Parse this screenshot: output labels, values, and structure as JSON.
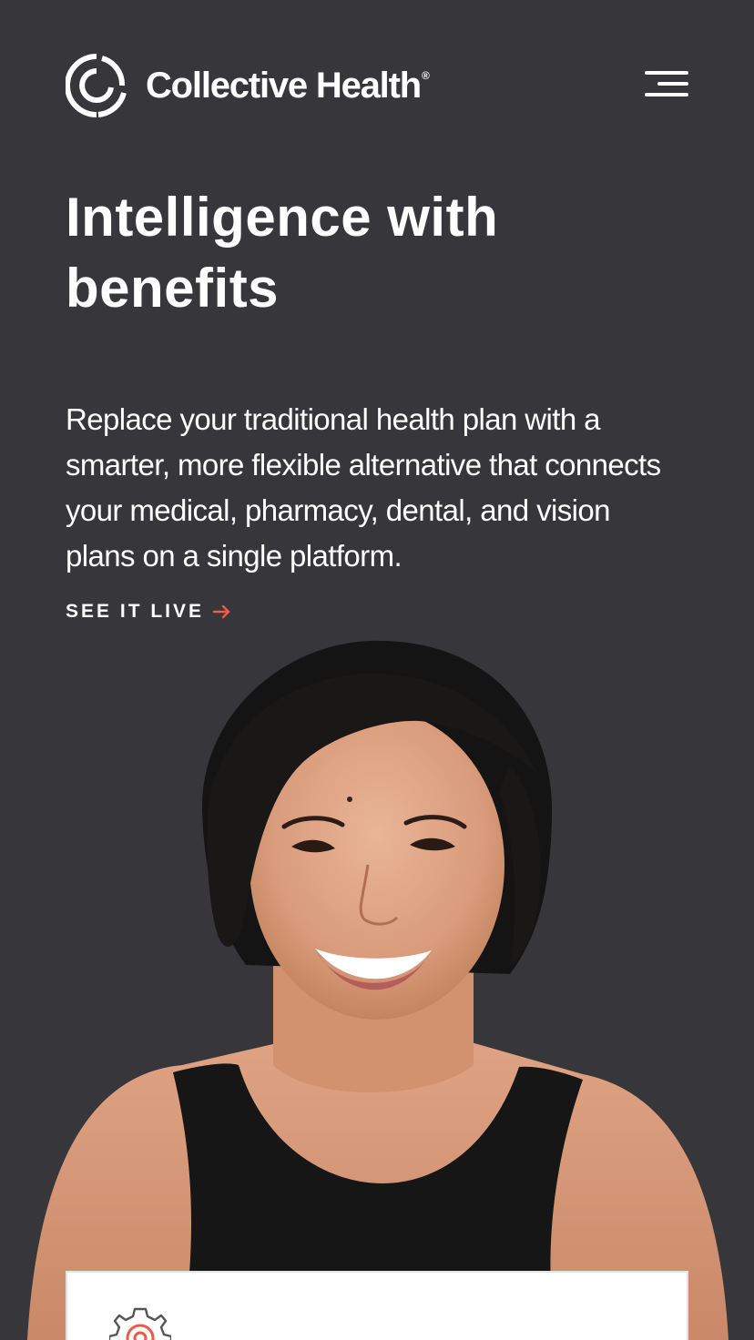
{
  "brand": {
    "name": "Collective Health",
    "registered_mark": "®",
    "accent_color": "#f0594a",
    "background_color": "#37363a"
  },
  "header": {
    "logo_icon": "collective-health-logo-mark",
    "menu_icon": "hamburger-menu-icon"
  },
  "hero": {
    "headline": "Intelligence with benefits",
    "body": "Replace your traditional health plan with a smarter, more flexible alternative that connects your medical, pharmacy, dental, and vision plans on a single platform.",
    "cta_label": "SEE IT LIVE",
    "cta_icon": "arrow-right-icon",
    "image": "smiling-woman-portrait"
  },
  "feature_card": {
    "icon": "gear-icon"
  }
}
